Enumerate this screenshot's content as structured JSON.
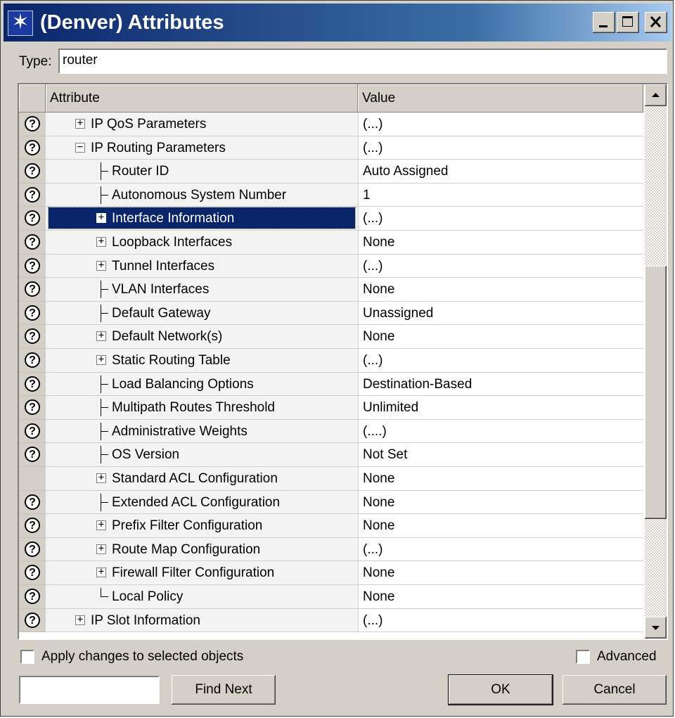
{
  "window": {
    "title": "(Denver) Attributes"
  },
  "type_field": {
    "label": "Type:",
    "value": "router"
  },
  "columns": {
    "attribute": "Attribute",
    "value": "Value"
  },
  "rows": [
    {
      "label": "IP QoS Parameters",
      "value": "(...)",
      "level": 1,
      "node": "plus",
      "help": true
    },
    {
      "label": "IP Routing Parameters",
      "value": "(...)",
      "level": 1,
      "node": "minus",
      "help": true
    },
    {
      "label": "Router ID",
      "value": "Auto Assigned",
      "level": 2,
      "node": "line",
      "help": true
    },
    {
      "label": "Autonomous System Number",
      "value": "1",
      "level": 2,
      "node": "line",
      "help": true
    },
    {
      "label": "Interface Information",
      "value": "(...)",
      "level": 2,
      "node": "plus",
      "help": true,
      "selected": true
    },
    {
      "label": "Loopback Interfaces",
      "value": "None",
      "level": 2,
      "node": "plus",
      "help": true
    },
    {
      "label": "Tunnel Interfaces",
      "value": "(...)",
      "level": 2,
      "node": "plus",
      "help": true
    },
    {
      "label": "VLAN Interfaces",
      "value": "None",
      "level": 2,
      "node": "line",
      "help": true
    },
    {
      "label": "Default Gateway",
      "value": "Unassigned",
      "level": 2,
      "node": "line",
      "help": true
    },
    {
      "label": "Default Network(s)",
      "value": "None",
      "level": 2,
      "node": "plus",
      "help": true
    },
    {
      "label": "Static Routing Table",
      "value": "(...)",
      "level": 2,
      "node": "plus",
      "help": true
    },
    {
      "label": "Load Balancing Options",
      "value": "Destination-Based",
      "level": 2,
      "node": "line",
      "help": true
    },
    {
      "label": "Multipath Routes Threshold",
      "value": "Unlimited",
      "level": 2,
      "node": "line",
      "help": true
    },
    {
      "label": "Administrative Weights",
      "value": "(....)",
      "level": 2,
      "node": "line",
      "help": true
    },
    {
      "label": "OS Version",
      "value": "Not Set",
      "level": 2,
      "node": "line",
      "help": true
    },
    {
      "label": "Standard ACL Configuration",
      "value": "None",
      "level": 2,
      "node": "plus",
      "help": false
    },
    {
      "label": "Extended ACL Configuration",
      "value": "None",
      "level": 2,
      "node": "line",
      "help": true
    },
    {
      "label": "Prefix Filter Configuration",
      "value": "None",
      "level": 2,
      "node": "plus",
      "help": true
    },
    {
      "label": "Route Map Configuration",
      "value": "(...)",
      "level": 2,
      "node": "plus",
      "help": true
    },
    {
      "label": "Firewall Filter Configuration",
      "value": "None",
      "level": 2,
      "node": "plus",
      "help": true
    },
    {
      "label": "Local Policy",
      "value": "None",
      "level": 2,
      "node": "last",
      "help": true
    },
    {
      "label": "IP Slot Information",
      "value": "(...)",
      "level": 1,
      "node": "plus",
      "help": true
    }
  ],
  "options": {
    "apply_label": "Apply changes to selected objects",
    "advanced_label": "Advanced"
  },
  "find": {
    "value": "",
    "button_label": "Find Next"
  },
  "buttons": {
    "ok": "OK",
    "cancel": "Cancel"
  }
}
